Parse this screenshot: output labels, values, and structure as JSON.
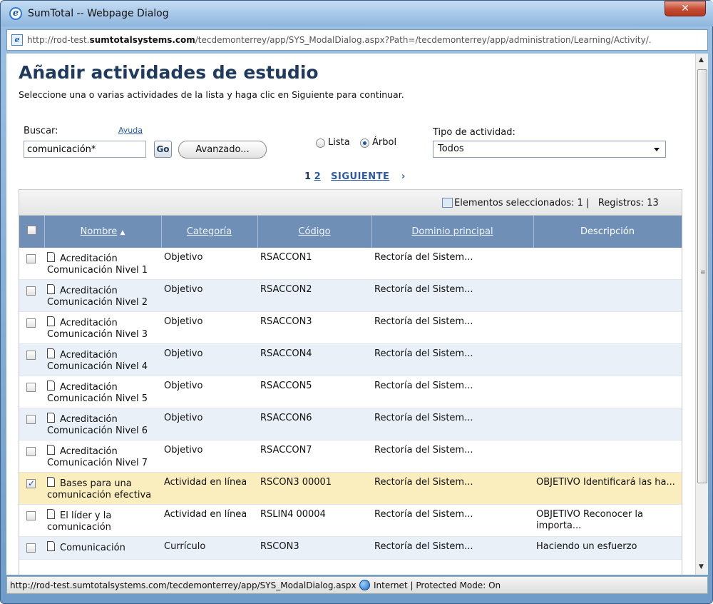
{
  "window": {
    "title": "SumTotal -- Webpage Dialog",
    "close_glyph": "✕",
    "url_prefix": "http://rod-test.",
    "url_host": "sumtotalsystems.com",
    "url_rest": "/tecdemonterrey/app/SYS_ModalDialog.aspx?Path=/tecdemonterrey/app/administration/Learning/Activity/."
  },
  "page": {
    "title": "Añadir actividades de estudio",
    "subtitle": "Seleccione una o varias actividades de la lista y haga clic en Siguiente para continuar."
  },
  "search": {
    "label": "Buscar:",
    "help_link": "Ayuda",
    "value": "comunicación*",
    "go_label": "Go",
    "advanced_label": "Avanzado...",
    "view_list": "Lista",
    "view_tree": "Árbol",
    "selected_view": "Árbol"
  },
  "activity_type": {
    "label": "Tipo de actividad:",
    "value": "Todos"
  },
  "pager": {
    "current": "1",
    "page2": "2",
    "next": "SIGUIENTE",
    "next_chevron": "›"
  },
  "grid": {
    "selected_label": "Elementos seleccionados: 1 |",
    "records_label": "Registros: 13",
    "columns": {
      "name": "Nombre",
      "sort_glyph": "▲",
      "category": "Categoría",
      "code": "Código",
      "domain": "Dominio principal",
      "description": "Descripción"
    },
    "rows": [
      {
        "name": "Acreditación Comunicación Nivel 1",
        "category": "Objetivo",
        "code": "RSACCON1",
        "domain": "Rectoría del Sistem...",
        "description": "",
        "checked": false
      },
      {
        "name": "Acreditación Comunicación Nivel 2",
        "category": "Objetivo",
        "code": "RSACCON2",
        "domain": "Rectoría del Sistem...",
        "description": "",
        "checked": false
      },
      {
        "name": "Acreditación Comunicación Nivel 3",
        "category": "Objetivo",
        "code": "RSACCON3",
        "domain": "Rectoría del Sistem...",
        "description": "",
        "checked": false
      },
      {
        "name": "Acreditación Comunicación Nivel 4",
        "category": "Objetivo",
        "code": "RSACCON4",
        "domain": "Rectoría del Sistem...",
        "description": "",
        "checked": false
      },
      {
        "name": "Acreditación Comunicación Nivel 5",
        "category": "Objetivo",
        "code": "RSACCON5",
        "domain": "Rectoría del Sistem...",
        "description": "",
        "checked": false
      },
      {
        "name": "Acreditación Comunicación Nivel 6",
        "category": "Objetivo",
        "code": "RSACCON6",
        "domain": "Rectoría del Sistem...",
        "description": "",
        "checked": false
      },
      {
        "name": "Acreditación Comunicación Nivel 7",
        "category": "Objetivo",
        "code": "RSACCON7",
        "domain": "Rectoría del Sistem...",
        "description": "",
        "checked": false
      },
      {
        "name": "Bases para una comunicación efectiva",
        "category": "Actividad en línea",
        "code": "RSCON3 00001",
        "domain": "Rectoría del Sistem...",
        "description": "OBJETIVO Identificará las ha...",
        "checked": true
      },
      {
        "name": "El líder y la comunicación",
        "category": "Actividad en línea",
        "code": "RSLIN4 00004",
        "domain": "Rectoría del Sistem...",
        "description": "OBJETIVO Reconocer la importa...",
        "checked": false
      },
      {
        "name": "Comunicación",
        "category": "Currículo",
        "code": "RSCON3",
        "domain": "Rectoría del Sistem...",
        "description": "Haciendo un esfuerzo",
        "checked": false
      }
    ]
  },
  "status": {
    "url": "http://rod-test.sumtotalsystems.com/tecdemonterrey/app/SYS_ModalDialog.aspx?Path=/tecdemonterrey",
    "zone": "Internet | Protected Mode: On"
  }
}
